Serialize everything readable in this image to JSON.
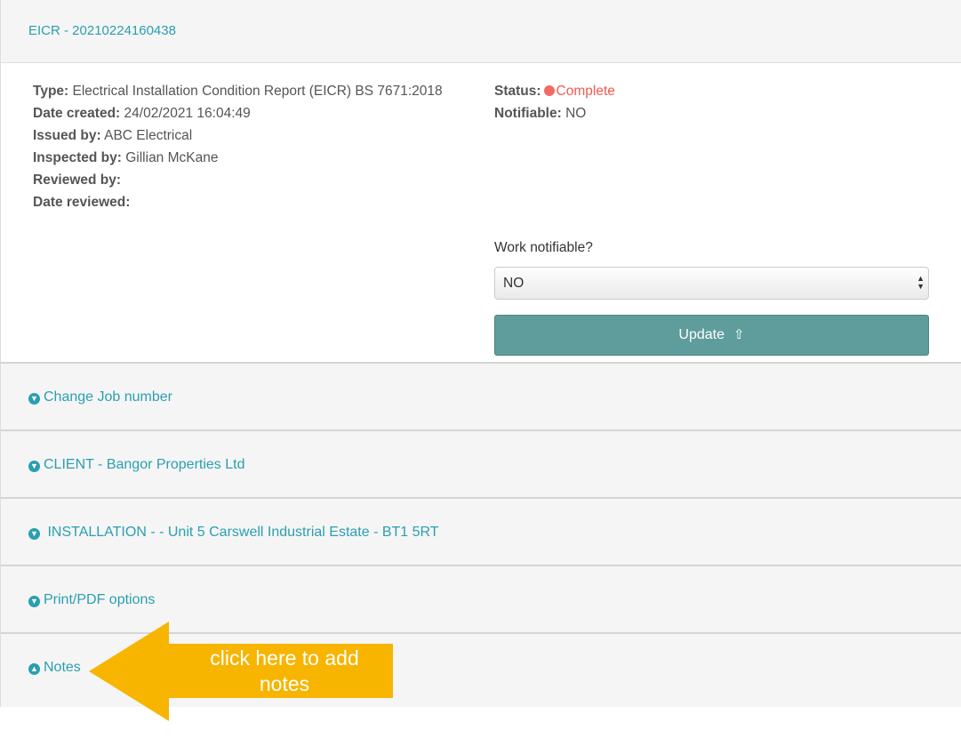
{
  "header": {
    "title": "EICR - 20210224160438"
  },
  "details": {
    "type_label": "Type:",
    "type_value": "Electrical Installation Condition Report (EICR) BS 7671:2018",
    "date_created_label": "Date created:",
    "date_created_value": "24/02/2021 16:04:49",
    "issued_by_label": "Issued by:",
    "issued_by_value": "ABC Electrical",
    "inspected_by_label": "Inspected by:",
    "inspected_by_value": "Gillian McKane",
    "reviewed_by_label": "Reviewed by:",
    "reviewed_by_value": "",
    "date_reviewed_label": "Date reviewed:",
    "date_reviewed_value": "",
    "status_label": "Status:",
    "status_value": "Complete",
    "status_color": "#f36a63",
    "notifiable_label": "Notifiable:",
    "notifiable_value": "NO"
  },
  "form": {
    "work_notifiable_label": "Work notifiable?",
    "work_notifiable_selected": "NO",
    "update_button_label": "Update",
    "update_icon": "upload-arrow-icon"
  },
  "sections": [
    {
      "label": "Change Job number",
      "icon": "circle-arrow-down-icon"
    },
    {
      "label": "CLIENT - Bangor Properties Ltd",
      "icon": "circle-arrow-down-icon"
    },
    {
      "label": " INSTALLATION - - Unit 5 Carswell Industrial Estate - BT1 5RT",
      "icon": "circle-arrow-down-icon"
    },
    {
      "label": "Print/PDF options",
      "icon": "circle-arrow-down-icon"
    },
    {
      "label": "Notes",
      "icon": "circle-arrow-up-icon"
    }
  ],
  "annotation": {
    "text": "click here to add notes",
    "color": "#f7b500"
  },
  "colors": {
    "accent_link": "#2a9fb0",
    "button": "#5e9d9b",
    "panel_bg": "#f5f5f5"
  }
}
